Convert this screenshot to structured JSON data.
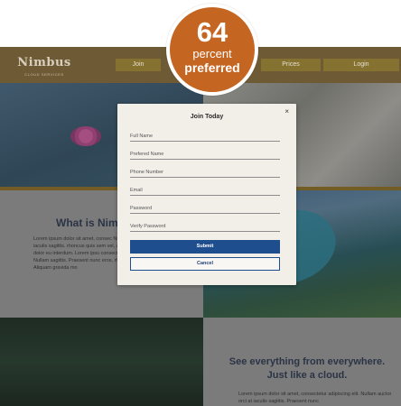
{
  "header": {
    "logo_text": "Nimbus",
    "logo_tagline": "CLOUD SERVICES",
    "nav": {
      "join": "Join",
      "prices": "Prices",
      "login": "Login"
    }
  },
  "sections": {
    "what_title": "What is Nimb",
    "what_body": "Lorem ipsum dolor sit amet, consec Nullam auctor orci at iaculis sagittis. rhoncus quis sem vel, aliquet sempe mollis dolor eu interdum. Lorem ipsu consectetur adipiscing elit. Nullam sagittis. Praesent nunc eros, rhoncu semper libero. Aliquam gravida mo",
    "see_title_line1": "See everything from everywhere.",
    "see_title_line2": "Just like a cloud.",
    "see_body": "Lorem ipsum dolor sit amet, consectetur adipiscing elit. Nullam auctor orci at iaculis sagittis. Praesent nunc"
  },
  "modal": {
    "title": "Join Today",
    "close_glyph": "×",
    "fields": {
      "full_name": "Full Name",
      "preferred_name": "Prefered Name",
      "phone_number": "Phone Number",
      "email": "Email",
      "password": "Password",
      "verify_password": "Verify Password"
    },
    "submit_label": "Submit",
    "cancel_label": "Cancel"
  },
  "badge": {
    "value": "64",
    "line1": "percent",
    "line2": "preferred"
  },
  "colors": {
    "accent_orange": "#c56522",
    "submit_blue": "#1f4e8f",
    "header_brown": "#6e5a34"
  }
}
